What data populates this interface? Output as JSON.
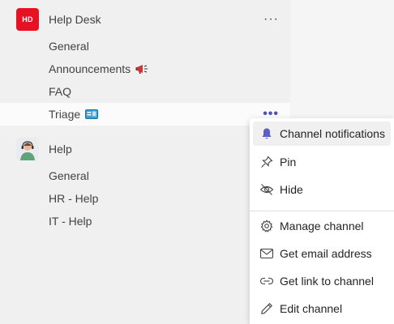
{
  "teams": [
    {
      "logo_text": "HD",
      "name": "Help Desk",
      "more_label": "···",
      "channels": [
        {
          "label": "General"
        },
        {
          "label": "Announcements",
          "emoji": "megaphone-icon"
        },
        {
          "label": "FAQ"
        },
        {
          "label": "Triage",
          "emoji": "id-card-icon",
          "more_label": "•••"
        }
      ]
    },
    {
      "logo_text": "",
      "name": "Help",
      "channels": [
        {
          "label": "General"
        },
        {
          "label": "HR - Help"
        },
        {
          "label": "IT - Help"
        }
      ]
    }
  ],
  "context_menu": {
    "items": [
      {
        "label": "Channel notifications",
        "icon": "bell-icon"
      },
      {
        "label": "Pin",
        "icon": "pin-icon"
      },
      {
        "label": "Hide",
        "icon": "eye-off-icon"
      },
      {
        "label": "Manage channel",
        "icon": "gear-icon"
      },
      {
        "label": "Get email address",
        "icon": "mail-icon"
      },
      {
        "label": "Get link to channel",
        "icon": "link-icon"
      },
      {
        "label": "Edit channel",
        "icon": "pencil-icon"
      }
    ]
  },
  "colors": {
    "accent": "#5b5fc7",
    "team_logo": "#e81123"
  }
}
